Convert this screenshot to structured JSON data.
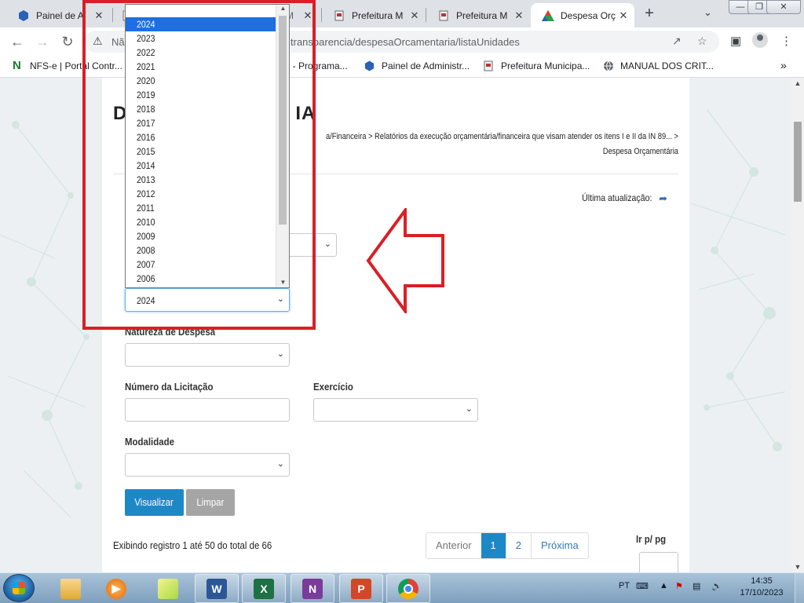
{
  "browser": {
    "tabs": [
      {
        "title": "Painel de A",
        "icon": "hexagon-icon"
      },
      {
        "title": "",
        "icon": "document-icon"
      },
      {
        "title": "M",
        "icon": "document-icon"
      },
      {
        "title": "Prefeitura M",
        "icon": "document-icon"
      },
      {
        "title": "Prefeitura M",
        "icon": "document-icon"
      },
      {
        "title": "Despesa Orç",
        "icon": "triangle-logo-icon",
        "active": true
      }
    ],
    "close_glyph": "✕",
    "new_tab_glyph": "+",
    "omnibox": {
      "security_text": "Nã",
      "url": "transparencia/despesaOrcamentaria/listaUnidades"
    },
    "bookmarks": [
      {
        "label": "NFS-e | Portal Contr...",
        "icon": "n-logo-icon"
      },
      {
        "label": "I - Programa...",
        "icon": "document-icon"
      },
      {
        "label": "Painel de Administr...",
        "icon": "hexagon-icon"
      },
      {
        "label": "Prefeitura Municipa...",
        "icon": "document-icon"
      },
      {
        "label": "MANUAL DOS CRIT...",
        "icon": "globe-icon"
      }
    ],
    "bookmarks_overflow": "»"
  },
  "page": {
    "title_left": "D",
    "title_right": "IA",
    "breadcrumb_line1": "a/Financeira > Relatórios da execução orçamentária/financeira que visam atender os itens I e II da IN 89... >",
    "breadcrumb_line2": "Despesa Orçamentária",
    "last_update_label": "Última atualização:",
    "dropdown_selected_value": "2024",
    "natureza_label": "Natureza de Despesa",
    "numero_licitacao_label": "Número da Licitação",
    "exercicio_label": "Exercício",
    "modalidade_label": "Modalidade",
    "visualizar_label": "Visualizar",
    "limpar_label": "Limpar",
    "records_text": "Exibindo registro 1 até 50 do total de 66",
    "pager": {
      "prev": "Anterior",
      "page1": "1",
      "page2": "2",
      "next": "Próxima"
    },
    "go_to_page_label": "Ir p/ pg"
  },
  "year_dropdown": {
    "options": [
      "2024",
      "2023",
      "2022",
      "2021",
      "2020",
      "2019",
      "2018",
      "2017",
      "2016",
      "2015",
      "2014",
      "2013",
      "2012",
      "2011",
      "2010",
      "2009",
      "2008",
      "2007",
      "2006"
    ],
    "selected": "2024"
  },
  "taskbar": {
    "apps": [
      {
        "name": "explorer",
        "icon": "folder-icon",
        "color": "#e8b84a"
      },
      {
        "name": "media-player",
        "icon": "media-player-icon",
        "color": "#2a7fd0"
      },
      {
        "name": "sticky-notes",
        "icon": "notes-icon",
        "color": "#c8d84a"
      },
      {
        "name": "word",
        "icon": "word-icon",
        "color": "#2b5797",
        "letter": "W"
      },
      {
        "name": "excel",
        "icon": "excel-icon",
        "color": "#1e7145",
        "letter": "X"
      },
      {
        "name": "onenote",
        "icon": "onenote-icon",
        "color": "#7a3b9a",
        "letter": "N"
      },
      {
        "name": "powerpoint",
        "icon": "powerpoint-icon",
        "color": "#d24726",
        "letter": "P"
      },
      {
        "name": "chrome",
        "icon": "chrome-icon",
        "color": "#4285f4"
      }
    ],
    "lang": "PT",
    "time": "14:35",
    "date": "17/10/2023"
  },
  "colors": {
    "accent": "#1e88c7",
    "highlight": "#d91f26",
    "selection": "#1e6fe0"
  }
}
